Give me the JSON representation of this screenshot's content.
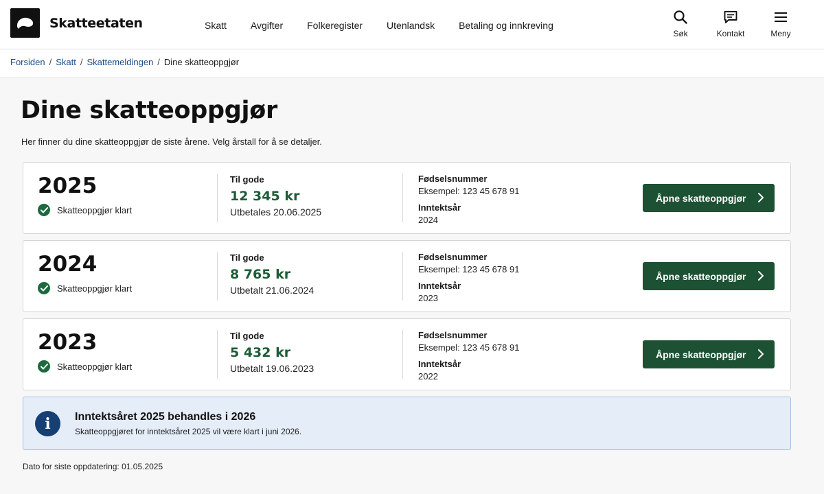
{
  "header": {
    "brand": "Skatteetaten",
    "nav": [
      "Skatt",
      "Avgifter",
      "Folkeregister",
      "Utenlandsk",
      "Betaling og innkreving"
    ],
    "tools": [
      {
        "label": "Søk",
        "icon": "search-icon"
      },
      {
        "label": "Kontakt",
        "icon": "chat-icon"
      },
      {
        "label": "Meny",
        "icon": "menu-icon"
      }
    ]
  },
  "breadcrumb": {
    "links": [
      "Forsiden",
      "Skatt",
      "Skattemeldingen"
    ],
    "current": "Dine skatteoppgjør"
  },
  "page": {
    "title": "Dine skatteoppgjør",
    "lead": "Her finner du dine skatteoppgjør de siste årene. Velg årstall for å se detaljer."
  },
  "settlements": [
    {
      "year": "2025",
      "status": "Skatteoppgjør klart",
      "amount_label": "Til gode",
      "amount": "12 345 kr",
      "payout": "Utbetales 20.06.2025",
      "id_label": "Fødselsnummer",
      "id_value": "Eksempel: 123 45 678 91",
      "income_year_label": "Inntektsår",
      "income_year": "2024",
      "button": "Åpne skatteoppgjør"
    },
    {
      "year": "2024",
      "status": "Skatteoppgjør klart",
      "amount_label": "Til gode",
      "amount": "8 765 kr",
      "payout": "Utbetalt 21.06.2024",
      "id_label": "Fødselsnummer",
      "id_value": "Eksempel: 123 45 678 91",
      "income_year_label": "Inntektsår",
      "income_year": "2023",
      "button": "Åpne skatteoppgjør"
    },
    {
      "year": "2023",
      "status": "Skatteoppgjør klart",
      "amount_label": "Til gode",
      "amount": "5 432 kr",
      "payout": "Utbetalt 19.06.2023",
      "id_label": "Fødselsnummer",
      "id_value": "Eksempel: 123 45 678 91",
      "income_year_label": "Inntektsår",
      "income_year": "2022",
      "button": "Åpne skatteoppgjør"
    }
  ],
  "info": {
    "title": "Inntektsåret 2025 behandles i 2026",
    "text": "Skatteoppgjøret for inntektsåret 2025 vil være klart i juni 2026."
  },
  "footer": {
    "updated": "Dato for siste oppdatering: 01.05.2025"
  },
  "colors": {
    "brand_dark": "#111111",
    "primary_green": "#1d5133",
    "amount_green": "#1d5c36",
    "link_blue": "#1a4c86",
    "info_bg": "#e5edf8",
    "info_icon": "#163f73"
  }
}
